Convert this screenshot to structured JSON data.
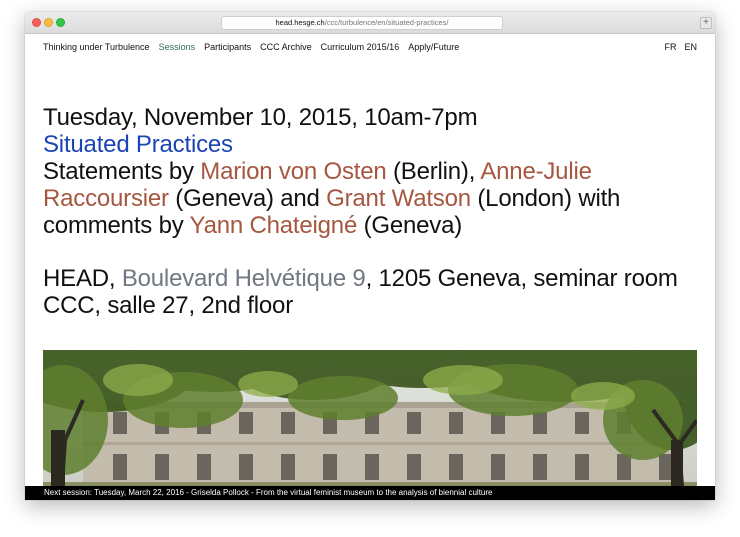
{
  "browser": {
    "url_host": "head.hesge.ch",
    "url_path": "/ccc/turbulence/en/situated-practices/",
    "newtab_label": "+"
  },
  "nav": {
    "items": [
      {
        "label": "Thinking under Turbulence",
        "active": false
      },
      {
        "label": "Sessions",
        "active": true
      },
      {
        "label": "Participants",
        "active": false
      },
      {
        "label": "CCC Archive",
        "active": false
      },
      {
        "label": "Curriculum 2015/16",
        "active": false
      },
      {
        "label": "Apply/Future",
        "active": false
      }
    ],
    "lang_fr": "FR",
    "lang_en": "EN"
  },
  "event": {
    "date": "Tuesday, November 10, 2015, 10am-7pm",
    "title": "Situated Practices",
    "statements_prefix": "Statements by ",
    "speakers": [
      {
        "name": "Marion von Osten",
        "city": " (Berlin), "
      },
      {
        "name": "Anne-Julie Raccoursier",
        "city": " (Geneva) and "
      },
      {
        "name": "Grant Watson",
        "city": " (London) with comments by "
      },
      {
        "name": "Yann Chateigné",
        "city": " (Geneva)"
      }
    ],
    "venue_name": "HEAD",
    "venue_sep": ", ",
    "venue_street": "Boulevard Helvétique 9",
    "venue_rest": ", 1205 Geneva, seminar room CCC, salle 27, 2nd floor"
  },
  "colors": {
    "active_nav": "#2d6e4d",
    "title": "#1b45b6",
    "person_link": "#a5573f",
    "address_link": "#717881"
  },
  "footer": {
    "text": "Next session: Tuesday, March 22, 2016 - Griselda Pollock - From the virtual feminist museum to the analysis of biennial culture"
  }
}
